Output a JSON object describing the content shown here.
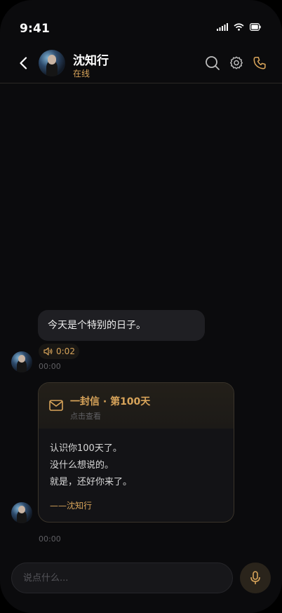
{
  "status_bar": {
    "time": "9:41"
  },
  "header": {
    "contact_name": "沈知行",
    "contact_status": "在线"
  },
  "messages": [
    {
      "type": "text",
      "text": "今天是个特别的日子。",
      "voice_duration": "0:02",
      "timestamp": "00:00"
    },
    {
      "type": "letter",
      "title": "一封信 · 第100天",
      "subtitle": "点击查看",
      "lines": [
        "认识你100天了。",
        "没什么想说的。",
        "就是，还好你来了。"
      ],
      "signature": "——沈知行",
      "timestamp": "00:00"
    }
  ],
  "composer": {
    "placeholder": "说点什么..."
  },
  "colors": {
    "accent": "#d8a45a",
    "background": "#0b0b0d",
    "bubble": "#1f1f23"
  },
  "icons": [
    "back-icon",
    "search-icon",
    "gear-icon",
    "phone-icon",
    "speaker-icon",
    "mail-icon",
    "mic-icon"
  ]
}
